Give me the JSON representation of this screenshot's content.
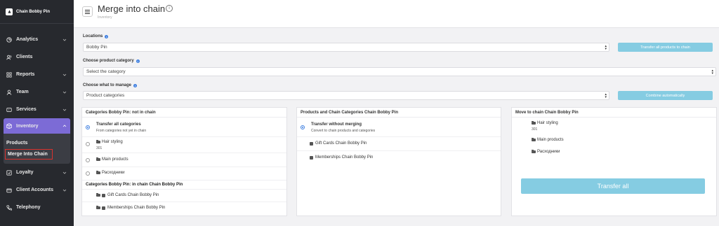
{
  "brand": {
    "name": "Chain Bobby Pin"
  },
  "sidebar": {
    "items": [
      {
        "label": "Analytics",
        "icon": "pie-chart-icon",
        "chevron": true
      },
      {
        "label": "Clients",
        "icon": "users-icon",
        "chevron": false
      },
      {
        "label": "Reports",
        "icon": "grid-icon",
        "chevron": true
      },
      {
        "label": "Team",
        "icon": "user-icon",
        "chevron": true
      },
      {
        "label": "Services",
        "icon": "services-icon",
        "chevron": true
      },
      {
        "label": "Inventory",
        "icon": "box-icon",
        "chevron": true,
        "active": true
      },
      {
        "label": "Loyalty",
        "icon": "loyalty-icon",
        "chevron": true
      },
      {
        "label": "Client Accounts",
        "icon": "wallet-icon",
        "chevron": true
      },
      {
        "label": "Telephony",
        "icon": "phone-icon",
        "chevron": false
      }
    ],
    "sub_items": [
      {
        "label": "Products"
      },
      {
        "label": "Merge Into Chain",
        "selected": true
      }
    ]
  },
  "header": {
    "title": "Merge into chain",
    "breadcrumb": "Inventory",
    "info": "i"
  },
  "form": {
    "locations_label": "Locations",
    "locations_value": "Bobby Pin",
    "transfer_all_btn": "Transfer all products to chain",
    "category_label": "Choose product category",
    "category_placeholder": "Select the category",
    "manage_label": "Choose what to manage",
    "manage_value": "Product categories",
    "combine_btn": "Combine automatically"
  },
  "panel_left": {
    "title": "Categories Bobby Pin: not in chain",
    "transfer_all_title": "Transfer all categories",
    "transfer_all_sub": "From categories not yet in chain",
    "items": [
      {
        "name": "Hair styling",
        "count": "301"
      },
      {
        "name": "Main products",
        "count": ""
      },
      {
        "name": "Расходники",
        "count": ""
      }
    ],
    "in_chain_title": "Categories Bobby Pin: in chain Chain Bobby Pin",
    "in_chain_items": [
      {
        "name": "Gift Cards Chain Bobby Pin"
      },
      {
        "name": "Memberships Chain Bobby Pin"
      }
    ]
  },
  "panel_middle": {
    "title": "Products and Chain Categories Chain Bobby Pin",
    "transfer_title": "Transfer without merging",
    "transfer_sub": "Convert to chain products and categories",
    "items": [
      {
        "name": "Gift Cards Chain Bobby Pin"
      },
      {
        "name": "Memberships Chain Bobby Pin"
      }
    ]
  },
  "panel_right": {
    "title": "Move to chain Chain Bobby Pin",
    "items": [
      {
        "name": "Hair styling",
        "count": "301"
      },
      {
        "name": "Main products",
        "count": ""
      },
      {
        "name": "Расходники",
        "count": ""
      }
    ],
    "transfer_btn": "Transfer all"
  },
  "colors": {
    "sidebar_bg": "#27292e",
    "active": "#7c6bd6",
    "button": "#85cce2",
    "accent": "#3d7ee0",
    "highlight_border": "#d9322e"
  }
}
